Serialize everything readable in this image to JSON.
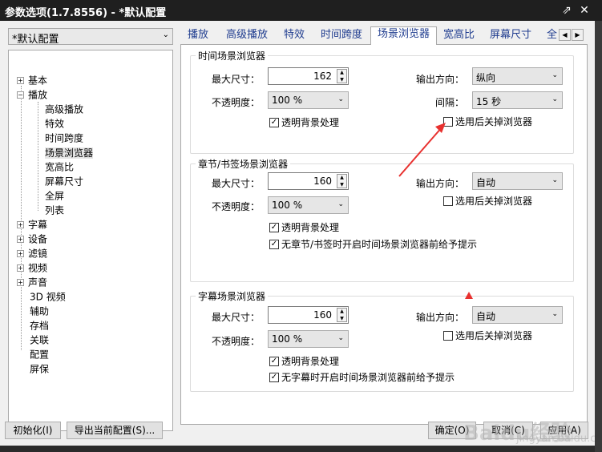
{
  "window": {
    "title": "参数选项(1.7.8556) - *默认配置",
    "pin_icon": "pin-icon",
    "close_icon": "close-icon"
  },
  "preset": {
    "value": "*默认配置"
  },
  "tree": {
    "items": [
      {
        "label": "基本",
        "expander": "+"
      },
      {
        "label": "播放",
        "expander": "−"
      },
      {
        "label": "高级播放"
      },
      {
        "label": "特效"
      },
      {
        "label": "时间跨度"
      },
      {
        "label": "场景浏览器"
      },
      {
        "label": "宽高比"
      },
      {
        "label": "屏幕尺寸"
      },
      {
        "label": "全屏"
      },
      {
        "label": "列表"
      },
      {
        "label": "字幕",
        "expander": "+"
      },
      {
        "label": "设备",
        "expander": "+"
      },
      {
        "label": "滤镜",
        "expander": "+"
      },
      {
        "label": "视频",
        "expander": "+"
      },
      {
        "label": "声音",
        "expander": "+"
      },
      {
        "label": "3D 视频"
      },
      {
        "label": "辅助"
      },
      {
        "label": "存档"
      },
      {
        "label": "关联"
      },
      {
        "label": "配置"
      },
      {
        "label": "屏保"
      }
    ]
  },
  "tabs": {
    "items": [
      "播放",
      "高级播放",
      "特效",
      "时间跨度",
      "场景浏览器",
      "宽高比",
      "屏幕尺寸",
      "全"
    ],
    "active": "场景浏览器"
  },
  "group_time": {
    "title": "时间场景浏览器",
    "max_size_label": "最大尺寸：",
    "max_size_value": "162",
    "opacity_label": "不透明度：",
    "opacity_value": "100 %",
    "transparent_bg": "透明背景处理",
    "output_dir_label": "输出方向：",
    "output_dir_value": "纵向",
    "interval_label": "间隔：",
    "interval_value": "15 秒",
    "close_after_select": "选用后关掉浏览器"
  },
  "group_chapter": {
    "title": "章节/书签场景浏览器",
    "max_size_label": "最大尺寸：",
    "max_size_value": "160",
    "opacity_label": "不透明度：",
    "opacity_value": "100 %",
    "transparent_bg": "透明背景处理",
    "no_chapter_hint": "无章节/书签时开启时间场景浏览器前给予提示",
    "output_dir_label": "输出方向：",
    "output_dir_value": "自动",
    "close_after_select": "选用后关掉浏览器"
  },
  "group_subtitle": {
    "title": "字幕场景浏览器",
    "max_size_label": "最大尺寸：",
    "max_size_value": "160",
    "opacity_label": "不透明度：",
    "opacity_value": "100 %",
    "transparent_bg": "透明背景处理",
    "no_subtitle_hint": "无字幕时开启时间场景浏览器前给予提示",
    "output_dir_label": "输出方向：",
    "output_dir_value": "自动",
    "close_after_select": "选用后关掉浏览器"
  },
  "buttons": {
    "init": "初始化(I)",
    "export": "导出当前配置(S)...",
    "ok": "确定(O)",
    "cancel": "取消(C)",
    "apply": "应用(A)"
  },
  "watermark": {
    "main": "Baidu经验",
    "sub": "jingyan.baidu.com"
  },
  "colors": {
    "title_bar": "#1f1f1f",
    "tab_text": "#1f3c8f",
    "annotation": "#e8312f"
  }
}
